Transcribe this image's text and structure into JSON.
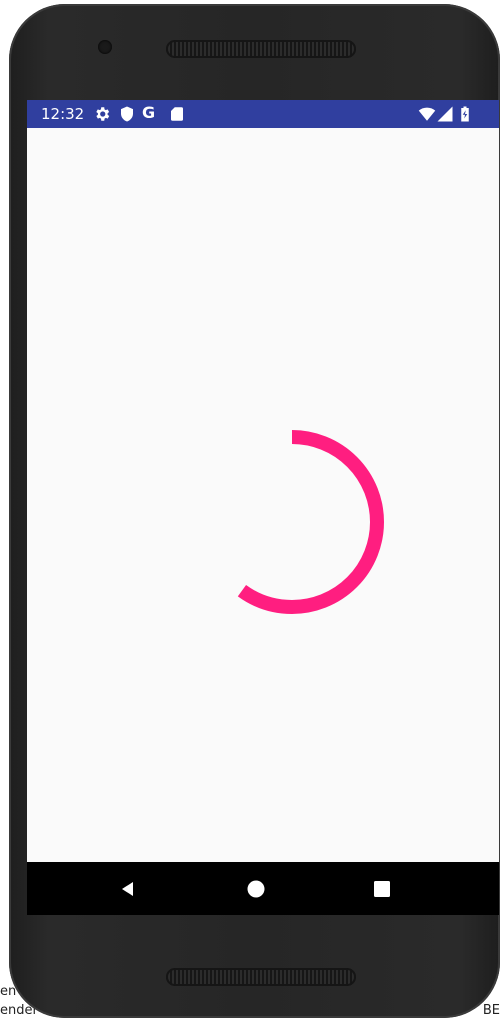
{
  "background": {
    "line1": "en",
    "line2": "ender",
    "right_text": "BE"
  },
  "status_bar": {
    "time": "12:32",
    "g_label": "G",
    "color": "#303f9f"
  },
  "status_icons_left": [
    "settings-icon",
    "shield-icon",
    "g-icon",
    "sd-card-icon"
  ],
  "status_icons_right": [
    "wifi-icon",
    "cell-signal-icon",
    "battery-charging-icon"
  ],
  "spinner": {
    "color": "#ff1e80",
    "progress": 0.6
  },
  "nav_bar": {
    "buttons": [
      "back",
      "home",
      "recents"
    ]
  },
  "colors": {
    "screen_background": "#fafafa",
    "nav_background": "#000000"
  }
}
